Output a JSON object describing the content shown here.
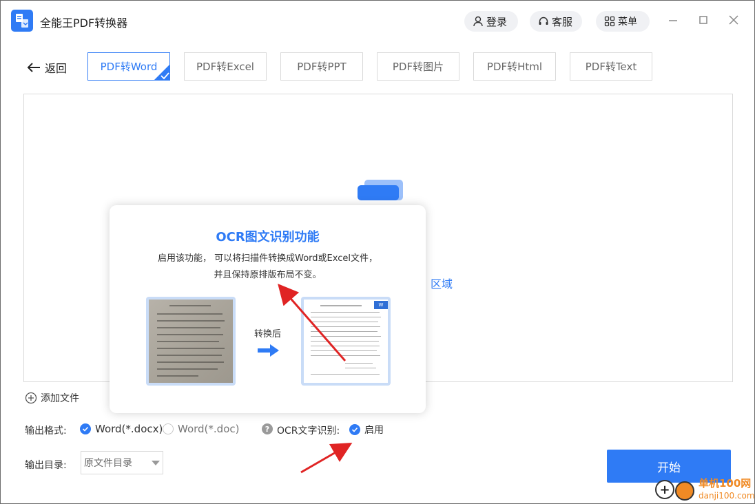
{
  "app": {
    "title": "全能王PDF转换器"
  },
  "titlebar": {
    "login": "登录",
    "service": "客服",
    "menu": "菜单"
  },
  "nav": {
    "back": "返回"
  },
  "tabs": [
    {
      "label": "PDF转Word",
      "active": true
    },
    {
      "label": "PDF转Excel",
      "active": false
    },
    {
      "label": "PDF转PPT",
      "active": false
    },
    {
      "label": "PDF转图片",
      "active": false
    },
    {
      "label": "PDF转Html",
      "active": false
    },
    {
      "label": "PDF转Text",
      "active": false
    }
  ],
  "drop_area": {
    "text_fragment": "区域"
  },
  "add_file": "添加文件",
  "output_format": {
    "label": "输出格式:",
    "options": [
      {
        "label": "Word(*.docx)",
        "selected": true
      },
      {
        "label": "Word(*.doc)",
        "selected": false
      }
    ]
  },
  "ocr": {
    "label": "OCR文字识别:",
    "option": "启用",
    "enabled": true
  },
  "output_dir": {
    "label": "输出目录:",
    "value": "原文件目录"
  },
  "start_button": "开始",
  "popup": {
    "title": "OCR图文识别功能",
    "desc_line1": "启用该功能，  可以将扫描件转换成Word或Excel文件，",
    "desc_line2": "并且保持原排版布局不变。",
    "convert_label": "转换后",
    "word_badge": "W"
  },
  "watermark": {
    "text1": "单机100网",
    "text2": "danji100.com"
  },
  "colors": {
    "accent": "#2f7bf5",
    "annotation": "#e02424"
  }
}
